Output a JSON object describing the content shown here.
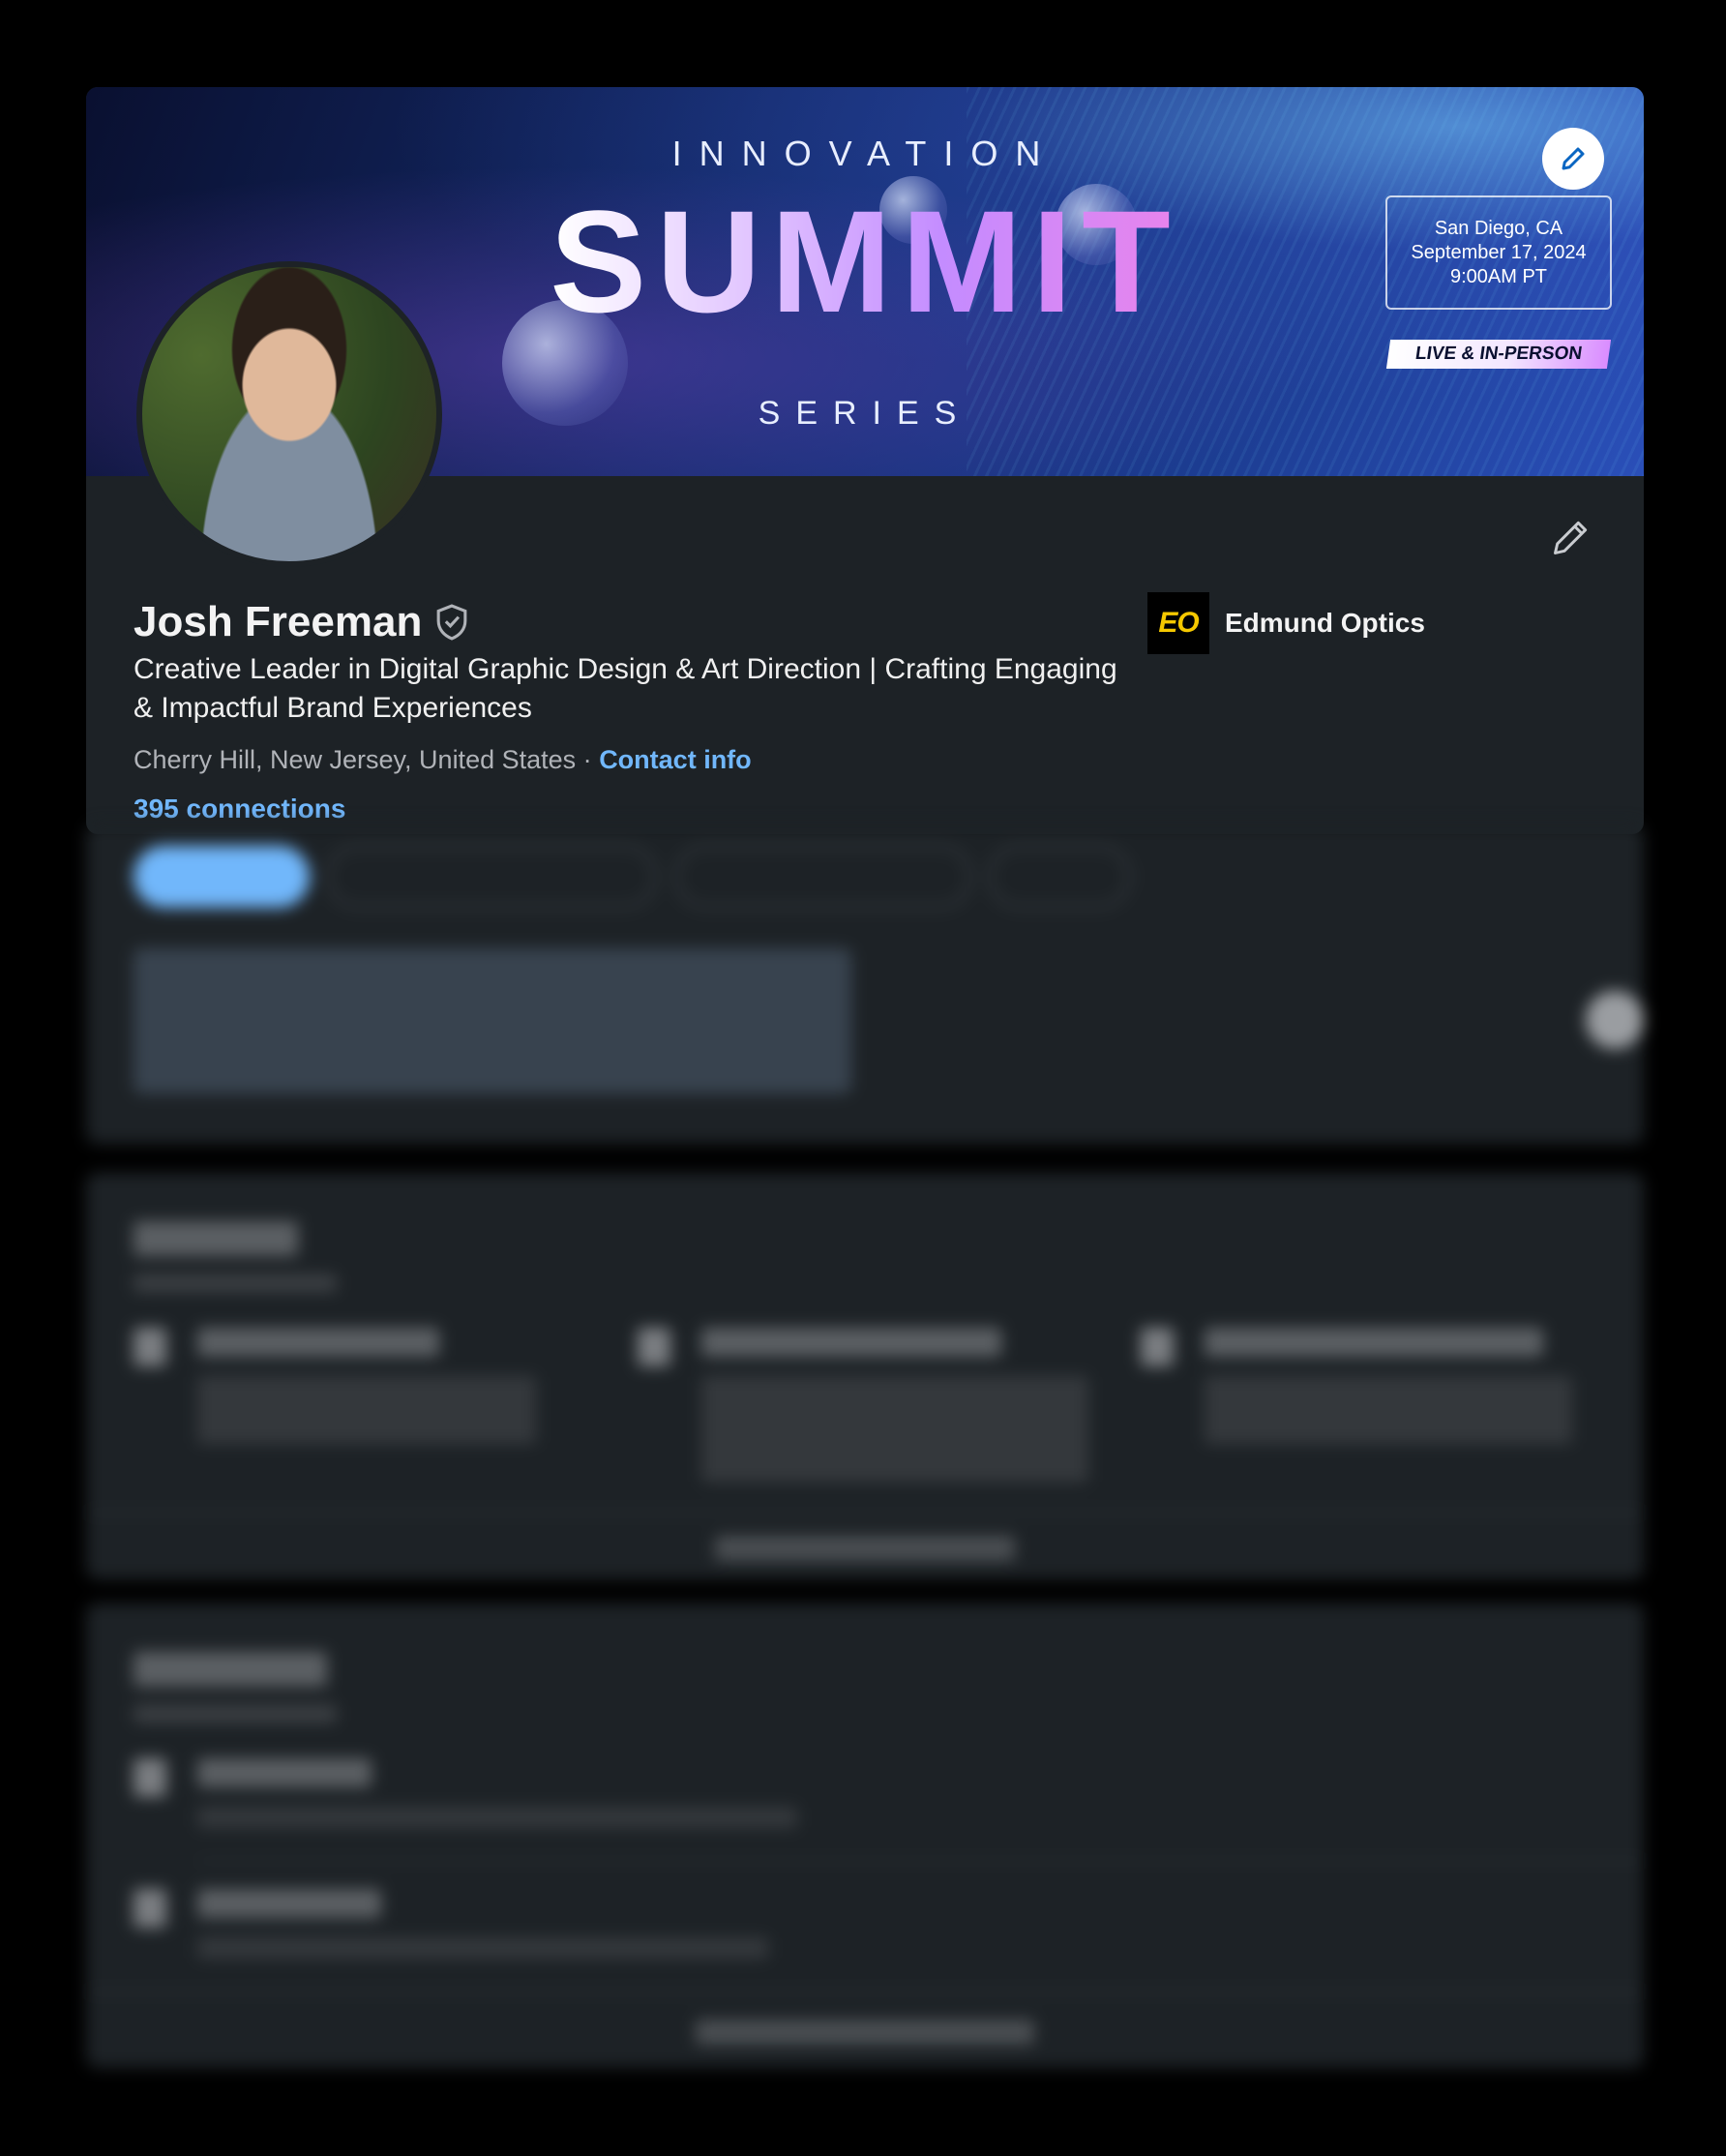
{
  "banner": {
    "top_text": "INNOVATION",
    "title": "SUMMIT",
    "subtitle": "SERIES",
    "event_lines": [
      "San Diego, CA",
      "September 17, 2024",
      "9:00AM PT"
    ],
    "live_tag": "LIVE & IN-PERSON",
    "edit_icon": "pencil-icon"
  },
  "profile": {
    "name": "Josh Freeman",
    "verified_icon": "shield-check-icon",
    "headline": "Creative Leader in Digital Graphic Design & Art Direction | Crafting Engaging & Impactful Brand Experiences",
    "location": "Cherry Hill, New Jersey, United States",
    "separator": "·",
    "contact_info": "Contact info",
    "connections": "395 connections",
    "edit_icon": "pencil-icon"
  },
  "company": {
    "logo_text": "EO",
    "name": "Edmund Optics"
  },
  "colors": {
    "page_bg": "#000000",
    "card_bg": "#1d2226",
    "link": "#71b7fb",
    "muted_text": "#b0b3b8"
  }
}
